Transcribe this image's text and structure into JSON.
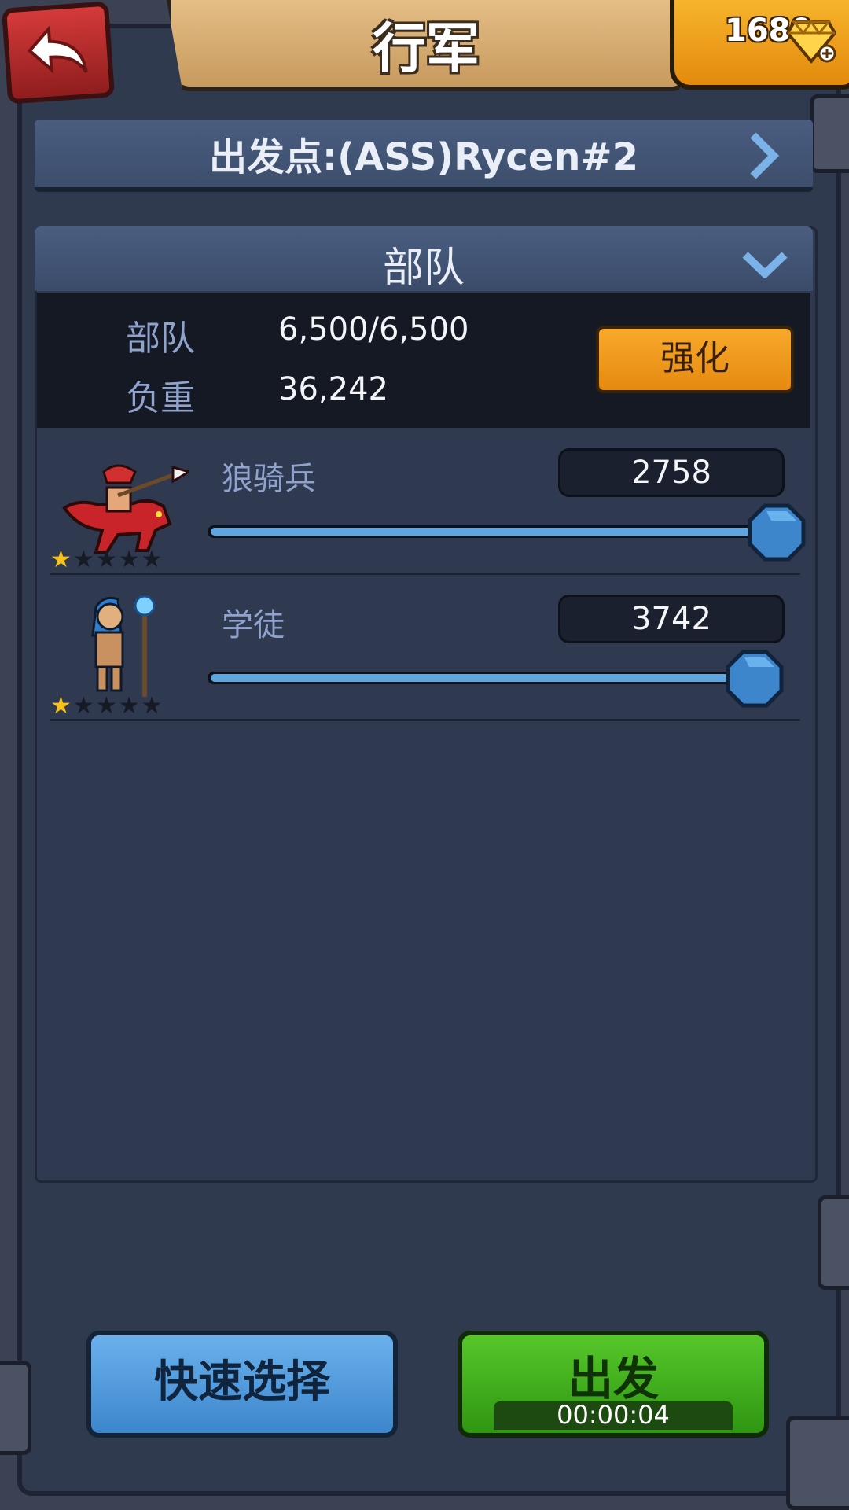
{
  "header": {
    "title": "行军",
    "gems": "1680"
  },
  "origin": {
    "label": "出发点:(ASS)Rycen#2"
  },
  "troops": {
    "header": "部队",
    "summary": {
      "troops_label": "部队",
      "troops_value": "6,500/6,500",
      "load_label": "负重",
      "load_value": "36,242"
    },
    "enhance_label": "强化",
    "units": [
      {
        "name": "狼骑兵",
        "count": "2758",
        "stars": 1,
        "max_stars": 5,
        "slider_level": 1.0
      },
      {
        "name": "学徒",
        "count": "3742",
        "stars": 1,
        "max_stars": 5,
        "slider_level": 1.0
      }
    ]
  },
  "footer": {
    "quick_select_label": "快速选择",
    "depart_label": "出发",
    "depart_timer": "00:00:04"
  },
  "colors": {
    "accent_blue": "#5ea6e0",
    "accent_orange": "#f39a1c",
    "accent_green": "#3fae1a",
    "back_red": "#c02b2b"
  },
  "icons": [
    "back-arrow-icon",
    "gem-icon",
    "chevron-right-icon",
    "chevron-down-icon",
    "star-icon"
  ]
}
